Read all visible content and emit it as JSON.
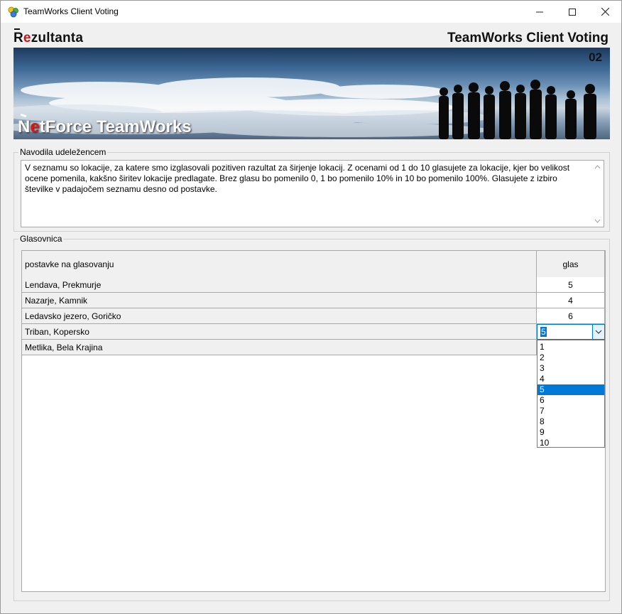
{
  "window": {
    "title": "TeamWorks Client Voting",
    "icon": "teamworks-app-icon",
    "controls": [
      "minimize-icon",
      "maximize-icon",
      "close-icon"
    ]
  },
  "header": {
    "brand_r": "R",
    "brand_e": "e",
    "brand_rest": "zultanta",
    "app_title": "TeamWorks Client Voting"
  },
  "banner": {
    "number": "02",
    "logo_n": "N",
    "logo_e": "e",
    "logo_rest": "tForce TeamWorks"
  },
  "instructions": {
    "label": "Navodila udeležencem",
    "text": "V seznamu so lokacije, za katere smo izglasovali pozitiven razultat za širjenje lokacij. Z ocenami od 1 do 10 glasujete za lokacije, kjer bo velikost ocene pomenila, kakšno širitev lokacije predlagate. Brez glasu bo pomenilo 0, 1 bo pomenilo 10% in 10 bo pomenilo 100%. Glasujete z izbiro številke v padajočem seznamu desno od postavke."
  },
  "ballot": {
    "label": "Glasovnica",
    "columns": [
      "postavke na glasovanju",
      "glas"
    ],
    "rows": [
      {
        "item": "Lendava, Prekmurje",
        "vote": "5"
      },
      {
        "item": "Nazarje, Kamnik",
        "vote": "4"
      },
      {
        "item": "Ledavsko jezero, Goričko",
        "vote": "6"
      },
      {
        "item": "Triban, Kopersko",
        "vote": "5"
      },
      {
        "item": "Metlika, Bela Krajina",
        "vote": ""
      }
    ],
    "dropdown": {
      "current": "5",
      "options": [
        "1",
        "2",
        "3",
        "4",
        "5",
        "6",
        "7",
        "8",
        "9",
        "10"
      ],
      "highlighted": "5"
    }
  },
  "colors": {
    "accent": "#0078d7",
    "brand_red": "#c21818",
    "panel_bg": "#f0f0f0"
  }
}
